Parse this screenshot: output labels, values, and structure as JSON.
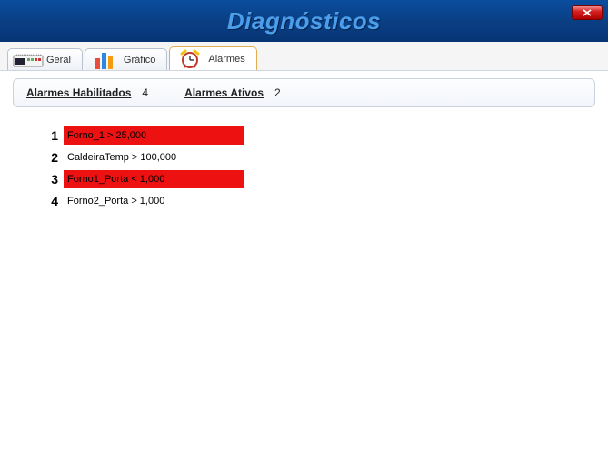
{
  "window": {
    "title": "Diagnósticos"
  },
  "tabs": [
    {
      "label": "Geral"
    },
    {
      "label": "Gráfico"
    },
    {
      "label": "Alarmes"
    }
  ],
  "summary": {
    "enabled_label": "Alarmes Habilitados",
    "enabled_count": "4",
    "active_label": "Alarmes Ativos",
    "active_count": "2"
  },
  "alarms": [
    {
      "index": "1",
      "text": "Forno_1 > 25,000",
      "active": true
    },
    {
      "index": "2",
      "text": "CaldeiraTemp > 100,000",
      "active": false
    },
    {
      "index": "3",
      "text": "Forno1_Porta < 1,000",
      "active": true
    },
    {
      "index": "4",
      "text": "Forno2_Porta > 1,000",
      "active": false
    }
  ]
}
